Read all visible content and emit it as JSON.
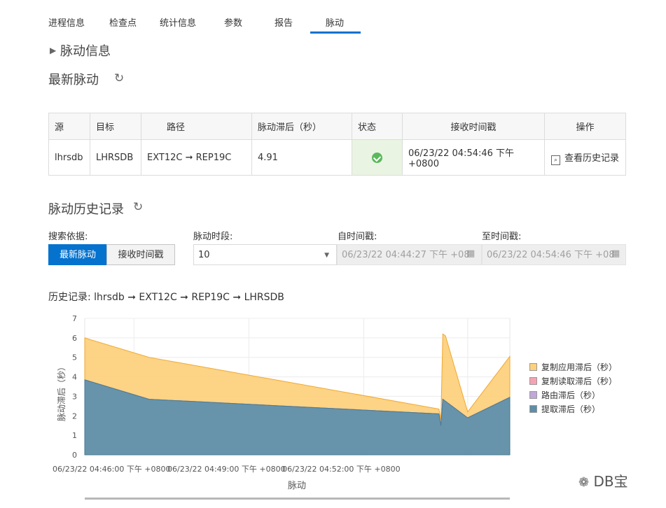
{
  "tabs": [
    "进程信息",
    "检查点",
    "统计信息",
    "参数",
    "报告",
    "脉动"
  ],
  "active_tab": "脉动",
  "heartbeat_info_title": "脉动信息",
  "latest": {
    "title": "最新脉动",
    "headers": [
      "源",
      "目标",
      "路径",
      "脉动滞后（秒）",
      "状态",
      "接收时间戳",
      "操作"
    ],
    "row": {
      "source": "lhrsdb",
      "target": "LHRSDB",
      "path": "EXT12C ➞ REP19C",
      "lag": "4.91",
      "status": "ok",
      "received": "06/23/22 04:54:46 下午 +0800",
      "action": "查看历史记录"
    }
  },
  "history": {
    "title": "脉动历史记录",
    "search_by_label": "搜索依据:",
    "btn_latest": "最新脉动",
    "btn_received": "接收时间戳",
    "period_label": "脉动时段:",
    "period_value": "10",
    "from_label": "自时间戳:",
    "from_value": "06/23/22 04:44:27 下午 +08",
    "to_label": "至时间戳:",
    "to_value": "06/23/22 04:54:46 下午 +08",
    "record_title": "历史记录:   lhrsdb ➞ EXT12C ➞ REP19C ➞ LHRSDB"
  },
  "watermark": "DB宝",
  "colors": {
    "accent": "#0572ce",
    "apply_lag": "#fdd17e",
    "read_lag": "#f5a3b4",
    "route_lag": "#c1a8d8",
    "extract_lag": "#5f8ea6"
  },
  "chart_data": {
    "type": "area",
    "stacked": true,
    "xlabel": "脉动",
    "ylabel": "脉动滞后（秒）",
    "ylim": [
      0,
      7
    ],
    "yticks": [
      0,
      1,
      2,
      3,
      4,
      5,
      6,
      7
    ],
    "x_tick_labels": [
      "06/23/22 04:46:00 下午 +0800",
      "06/23/22 04:49:00 下午 +0800",
      "06/23/22 04:52:00 下午 +0800"
    ],
    "x_minutes_from_4_46": [
      -0.7,
      0.98,
      8.55,
      8.6,
      8.65,
      8.72,
      9.3,
      10.4
    ],
    "series": [
      {
        "name": "提取滞后（秒）",
        "values": [
          3.85,
          2.85,
          2.1,
          1.5,
          2.85,
          2.75,
          1.9,
          2.95
        ]
      },
      {
        "name": "路由滞后（秒）",
        "values": [
          0,
          0,
          0,
          0,
          0,
          0,
          0,
          0
        ]
      },
      {
        "name": "复制读取滞后（秒）",
        "values": [
          0,
          0,
          0,
          0,
          0,
          0,
          0,
          0
        ]
      },
      {
        "name": "复制应用滞后（秒）",
        "values": [
          2.15,
          2.15,
          0.25,
          0.3,
          3.35,
          3.35,
          0.3,
          2.1
        ]
      }
    ],
    "legend_position": "right",
    "grid": true
  }
}
